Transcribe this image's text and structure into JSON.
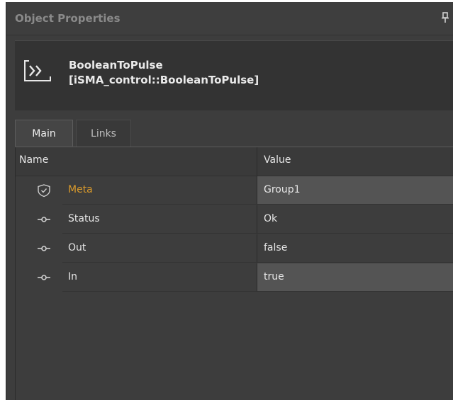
{
  "panel": {
    "title": "Object Properties",
    "pin_icon": "pin-icon"
  },
  "component": {
    "name": "BooleanToPulse",
    "type": "[iSMA_control::BooleanToPulse]",
    "icon": "block-icon"
  },
  "tabs": [
    {
      "label": "Main",
      "active": true
    },
    {
      "label": "Links",
      "active": false
    }
  ],
  "grid": {
    "columns": {
      "name": "Name",
      "value": "Value"
    },
    "rows": [
      {
        "icon": "shield-icon",
        "name": "Meta",
        "value": "Group1"
      },
      {
        "icon": "slot-icon",
        "name": "Status",
        "value": "Ok"
      },
      {
        "icon": "slot-icon",
        "name": "Out",
        "value": "false"
      },
      {
        "icon": "slot-icon",
        "name": "In",
        "value": "true"
      }
    ]
  },
  "colors": {
    "background": "#3d3d3d",
    "accent_meta": "#d99a2b",
    "text": "#e6e6e6",
    "title_text": "#8a8a8a"
  }
}
